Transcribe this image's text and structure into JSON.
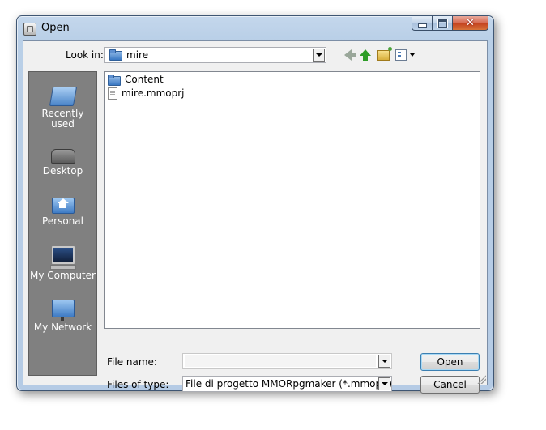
{
  "window": {
    "title": "Open",
    "controls": {
      "minimize": "minimize",
      "maximize": "maximize",
      "close": "✕"
    }
  },
  "toolbar": {
    "look_in_label": "Look in:",
    "look_in_value": "mire",
    "icons": [
      "back-arrow-icon",
      "up-folder-icon",
      "new-folder-icon",
      "views-menu-icon"
    ]
  },
  "places": [
    {
      "label": "Recently used",
      "icon": "recent-icon"
    },
    {
      "label": "Desktop",
      "icon": "desktop-icon"
    },
    {
      "label": "Personal",
      "icon": "personal-folder-icon"
    },
    {
      "label": "My Computer",
      "icon": "computer-icon"
    },
    {
      "label": "My Network",
      "icon": "network-icon"
    }
  ],
  "files": [
    {
      "name": "Content",
      "type": "folder"
    },
    {
      "name": "mire.mmoprj",
      "type": "file"
    }
  ],
  "form": {
    "file_name_label": "File name:",
    "file_name_value": "",
    "files_of_type_label": "Files of type:",
    "files_of_type_value": "File di progetto MMORpgmaker (*.mmoprj)"
  },
  "buttons": {
    "open": "Open",
    "cancel": "Cancel"
  },
  "colors": {
    "places_bg": "#808080",
    "window_frame": "#b9cfe7",
    "close_button": "#c3401e"
  }
}
